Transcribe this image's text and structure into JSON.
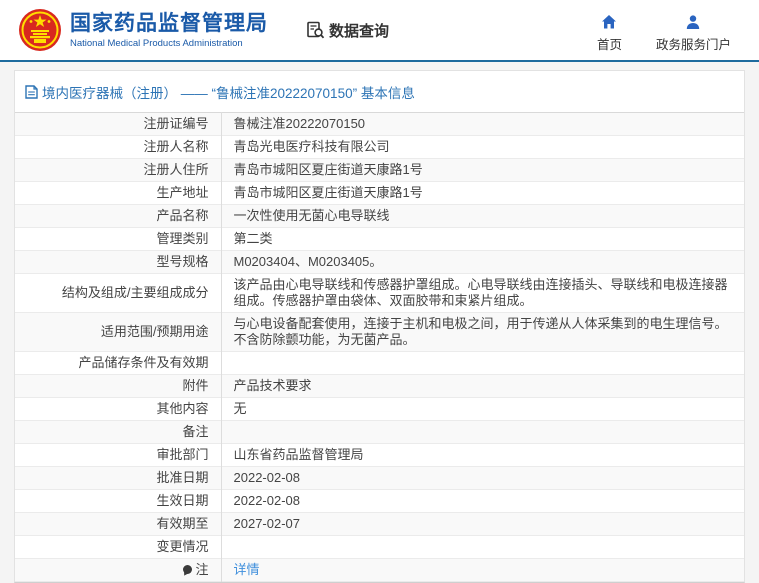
{
  "header": {
    "org_name_zh": "国家药品监督管理局",
    "org_name_en": "National Medical Products Administration",
    "data_query_label": "数据查询",
    "nav": [
      {
        "label": "首页",
        "icon": "home-icon"
      },
      {
        "label": "政务服务门户",
        "icon": "user-icon"
      }
    ]
  },
  "breadcrumb": {
    "title": "境内医疗器械（注册） ——  “鲁械注准20222070150”  基本信息"
  },
  "table": {
    "rows": [
      {
        "label": "注册证编号",
        "value": "鲁械注准20222070150"
      },
      {
        "label": "注册人名称",
        "value": "青岛光电医疗科技有限公司"
      },
      {
        "label": "注册人住所",
        "value": "青岛市城阳区夏庄街道天康路1号"
      },
      {
        "label": "生产地址",
        "value": "青岛市城阳区夏庄街道天康路1号"
      },
      {
        "label": "产品名称",
        "value": "一次性使用无菌心电导联线"
      },
      {
        "label": "管理类别",
        "value": "第二类"
      },
      {
        "label": "型号规格",
        "value": "M0203404、M0203405。"
      },
      {
        "label": "结构及组成/主要组成成分",
        "value": "该产品由心电导联线和传感器护罩组成。心电导联线由连接插头、导联线和电极连接器组成。传感器护罩由袋体、双面胶带和束紧片组成。"
      },
      {
        "label": "适用范围/预期用途",
        "value": "与心电设备配套使用，连接于主机和电极之间，用于传递从人体采集到的电生理信号。不含防除颤功能，为无菌产品。"
      },
      {
        "label": "产品储存条件及有效期",
        "value": ""
      },
      {
        "label": "附件",
        "value": "产品技术要求"
      },
      {
        "label": "其他内容",
        "value": "无"
      },
      {
        "label": "备注",
        "value": ""
      },
      {
        "label": "审批部门",
        "value": "山东省药品监督管理局"
      },
      {
        "label": "批准日期",
        "value": "2022-02-08"
      },
      {
        "label": "生效日期",
        "value": "2022-02-08"
      },
      {
        "label": "有效期至",
        "value": "2027-02-07"
      },
      {
        "label": "变更情况",
        "value": ""
      },
      {
        "label": "注",
        "value": "详情",
        "is_link": true,
        "has_icon": true
      }
    ]
  },
  "colors": {
    "brand_blue": "#1a5aa8",
    "header_rule_blue": "#1d6b9e",
    "breadcrumb_blue": "#2d74b5",
    "link_blue": "#3f8fdc",
    "nav_icon_blue": "#2a64c0",
    "emblem_red": "#d8291f",
    "emblem_yellow": "#ffde00",
    "row_alt_bg": "#f9f9f9"
  }
}
